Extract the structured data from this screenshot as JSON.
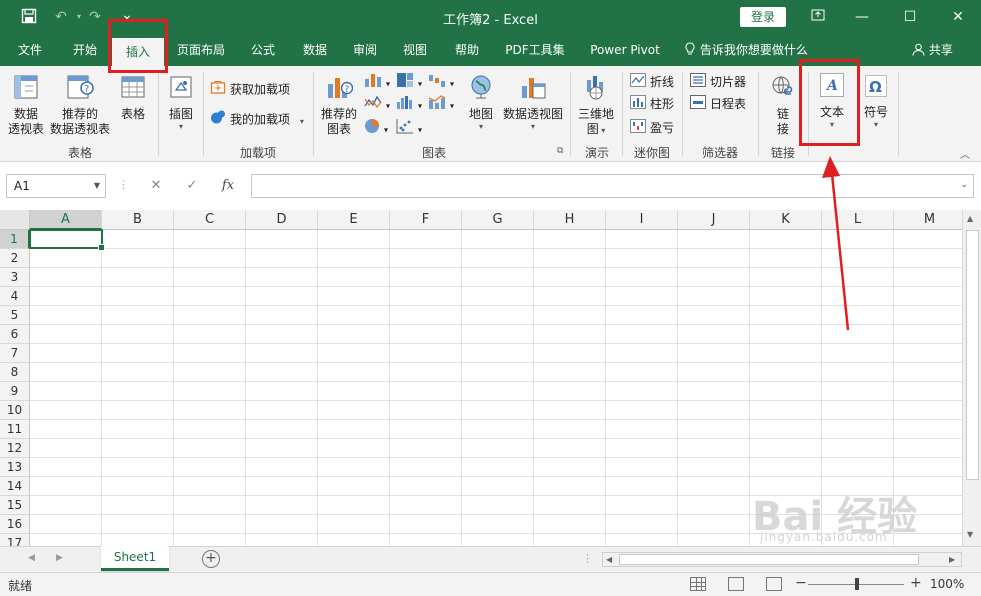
{
  "window": {
    "title": "工作簿2  -  Excel",
    "login_label": "登录",
    "qat_icons": [
      "save-icon",
      "undo-icon",
      "redo-icon",
      "customize-icon"
    ],
    "controls": [
      "ribbon-display-icon",
      "minimize-icon",
      "maximize-icon",
      "close-icon"
    ]
  },
  "tabs": [
    {
      "label": "文件"
    },
    {
      "label": "开始"
    },
    {
      "label": "插入",
      "active": true
    },
    {
      "label": "页面布局"
    },
    {
      "label": "公式"
    },
    {
      "label": "数据"
    },
    {
      "label": "审阅"
    },
    {
      "label": "视图"
    },
    {
      "label": "帮助"
    },
    {
      "label": "PDF工具集"
    },
    {
      "label": "Power Pivot"
    }
  ],
  "tell_me": "告诉我你想要做什么",
  "share": "共享",
  "ribbon": {
    "tables": {
      "pivot_line1": "数据",
      "pivot_line2": "透视表",
      "rec_pivot_line1": "推荐的",
      "rec_pivot_line2": "数据透视表",
      "table": "表格",
      "group": "表格"
    },
    "illustrations": {
      "label": "插图"
    },
    "addins": {
      "get": "获取加载项",
      "my": "我的加载项",
      "group": "加载项"
    },
    "charts": {
      "rec_line1": "推荐的",
      "rec_line2": "图表",
      "map": "地图",
      "pivotchart": "数据透视图",
      "group": "图表"
    },
    "tours": {
      "line1": "三维地",
      "line2": "图",
      "group": "演示"
    },
    "sparklines": {
      "line": "折线",
      "column": "柱形",
      "winloss": "盈亏",
      "group": "迷你图"
    },
    "filters": {
      "slicer": "切片器",
      "timeline": "日程表",
      "group": "筛选器"
    },
    "links": {
      "line1": "链",
      "line2": "接",
      "group": "链接"
    },
    "text": {
      "label": "文本"
    },
    "symbols": {
      "label": "符号"
    }
  },
  "formula_bar": {
    "name_box": "A1",
    "fx": "fx",
    "value": ""
  },
  "grid": {
    "columns": [
      "A",
      "B",
      "C",
      "D",
      "E",
      "F",
      "G",
      "H",
      "I",
      "J",
      "K",
      "L",
      "M"
    ],
    "rows": [
      "1",
      "2",
      "3",
      "4",
      "5",
      "6",
      "7",
      "8",
      "9",
      "10",
      "11",
      "12",
      "13",
      "14",
      "15",
      "16",
      "17"
    ],
    "active_cell": "A1"
  },
  "sheets": [
    {
      "label": "Sheet1",
      "active": true
    }
  ],
  "status": {
    "text": "就绪",
    "zoom": "100%"
  },
  "watermark": {
    "logo": "Bai 经验",
    "url": "jingyan.baidu.com"
  },
  "colors": {
    "brand": "#217346",
    "annotation": "#e02020"
  }
}
